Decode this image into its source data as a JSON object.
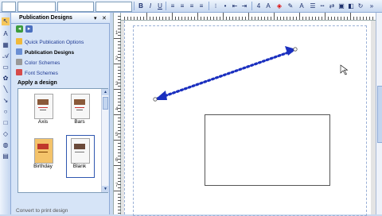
{
  "toolbar": {
    "font_size": "4"
  },
  "task_pane": {
    "title": "Publication Designs",
    "dropdown_glyph": "▾",
    "close_glyph": "✕",
    "items": [
      {
        "label": "Quick Publication Options",
        "icon": "quick-options-icon"
      },
      {
        "label": "Publication Designs",
        "icon": "designs-icon",
        "active": true
      },
      {
        "label": "Color Schemes",
        "icon": "color-schemes-icon"
      },
      {
        "label": "Font Schemes",
        "icon": "font-schemes-icon"
      }
    ],
    "apply_heading": "Apply a design",
    "designs": [
      {
        "label": "Axis"
      },
      {
        "label": "Bars"
      },
      {
        "label": "Birthday"
      },
      {
        "label": "Blank",
        "selected": true
      }
    ],
    "bottom_text": "Convert to print design"
  },
  "ruler": {
    "v_numbers": [
      "1",
      "2",
      "3",
      "4",
      "5",
      "6",
      "7"
    ]
  },
  "colors": {
    "accent": "#1f3a93",
    "arrow": "#1a2fbf",
    "pane_bg": "#d6e4f7"
  }
}
